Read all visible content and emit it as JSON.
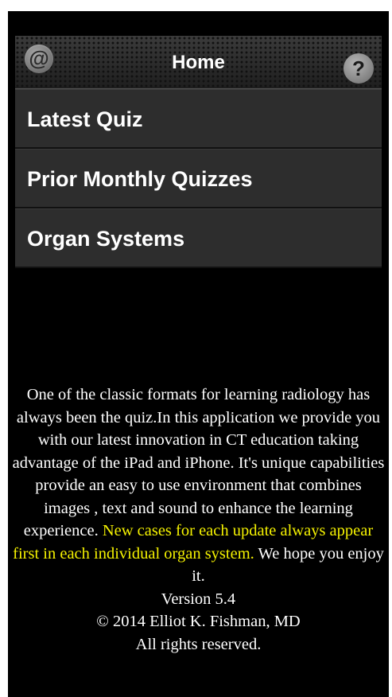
{
  "navbar": {
    "title": "Home",
    "left_icon": "at-icon",
    "left_icon_glyph": "@",
    "right_icon": "help-icon",
    "right_icon_glyph": "?"
  },
  "menu": {
    "items": [
      {
        "label": "Latest Quiz"
      },
      {
        "label": "Prior Monthly Quizzes"
      },
      {
        "label": "Organ Systems"
      }
    ]
  },
  "description": {
    "text_before": "One of the classic formats for learning radiology has always been the quiz.In this application we provide you with our latest innovation in CT education taking advantage of the iPad and iPhone. It's unique capabilities provide an easy to use environment that combines images , text and sound to enhance the learning experience.",
    "highlight": "New cases for each update always appear first in each individual organ system.",
    "text_after": "We hope you enjoy it.",
    "version": "Version 5.4",
    "copyright": "© 2014 Elliot K. Fishman, MD",
    "rights": "All rights reserved."
  },
  "colors": {
    "background": "#000000",
    "menu_item": "#2d2d2d",
    "highlight_text": "#f5f200",
    "text": "#ffffff"
  }
}
